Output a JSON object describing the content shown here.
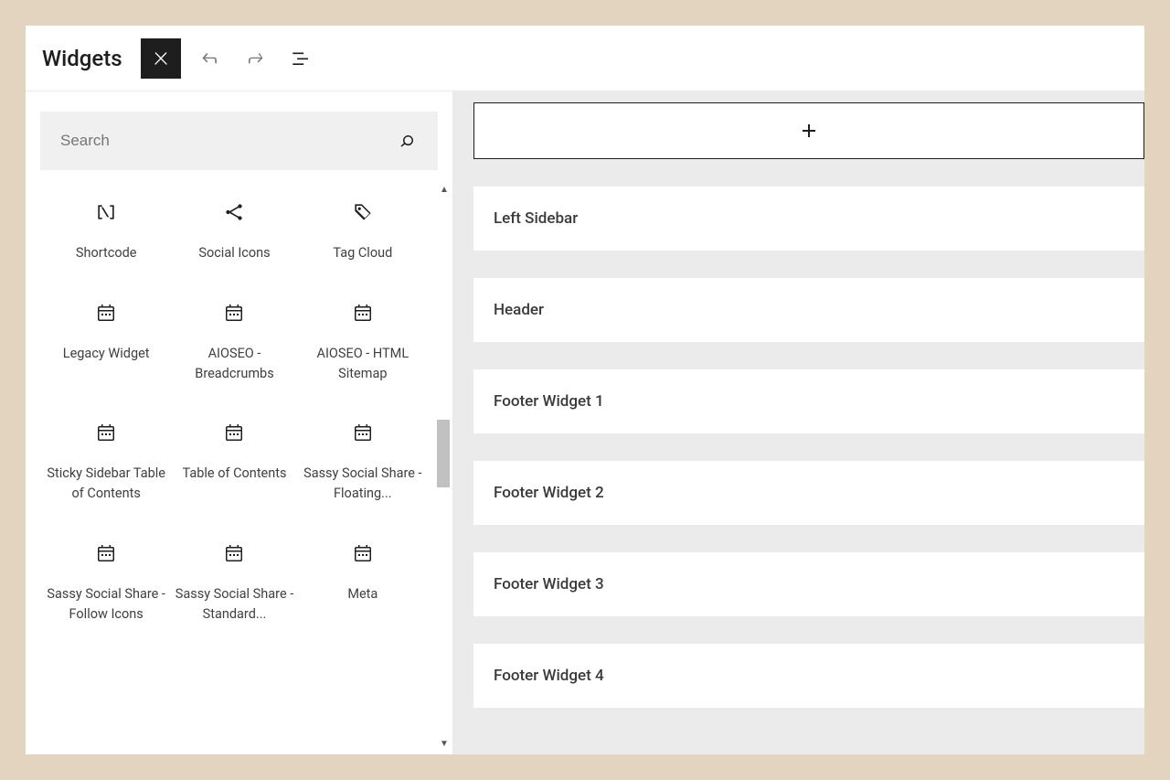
{
  "title": "Widgets",
  "search": {
    "placeholder": "Search"
  },
  "blocks": [
    {
      "label": "Shortcode",
      "icon": "shortcode"
    },
    {
      "label": "Social Icons",
      "icon": "share"
    },
    {
      "label": "Tag Cloud",
      "icon": "tag"
    },
    {
      "label": "Legacy Widget",
      "icon": "calendar"
    },
    {
      "label": "AIOSEO - Breadcrumbs",
      "icon": "calendar"
    },
    {
      "label": "AIOSEO - HTML Sitemap",
      "icon": "calendar"
    },
    {
      "label": "Sticky Sidebar Table of Contents",
      "icon": "calendar"
    },
    {
      "label": "Table of Contents",
      "icon": "calendar"
    },
    {
      "label": "Sassy Social Share - Floating...",
      "icon": "calendar"
    },
    {
      "label": "Sassy Social Share - Follow Icons",
      "icon": "calendar"
    },
    {
      "label": "Sassy Social Share - Standard...",
      "icon": "calendar"
    },
    {
      "label": "Meta",
      "icon": "calendar"
    }
  ],
  "areas": [
    "Left Sidebar",
    "Header",
    "Footer Widget 1",
    "Footer Widget 2",
    "Footer Widget 3",
    "Footer Widget 4"
  ]
}
